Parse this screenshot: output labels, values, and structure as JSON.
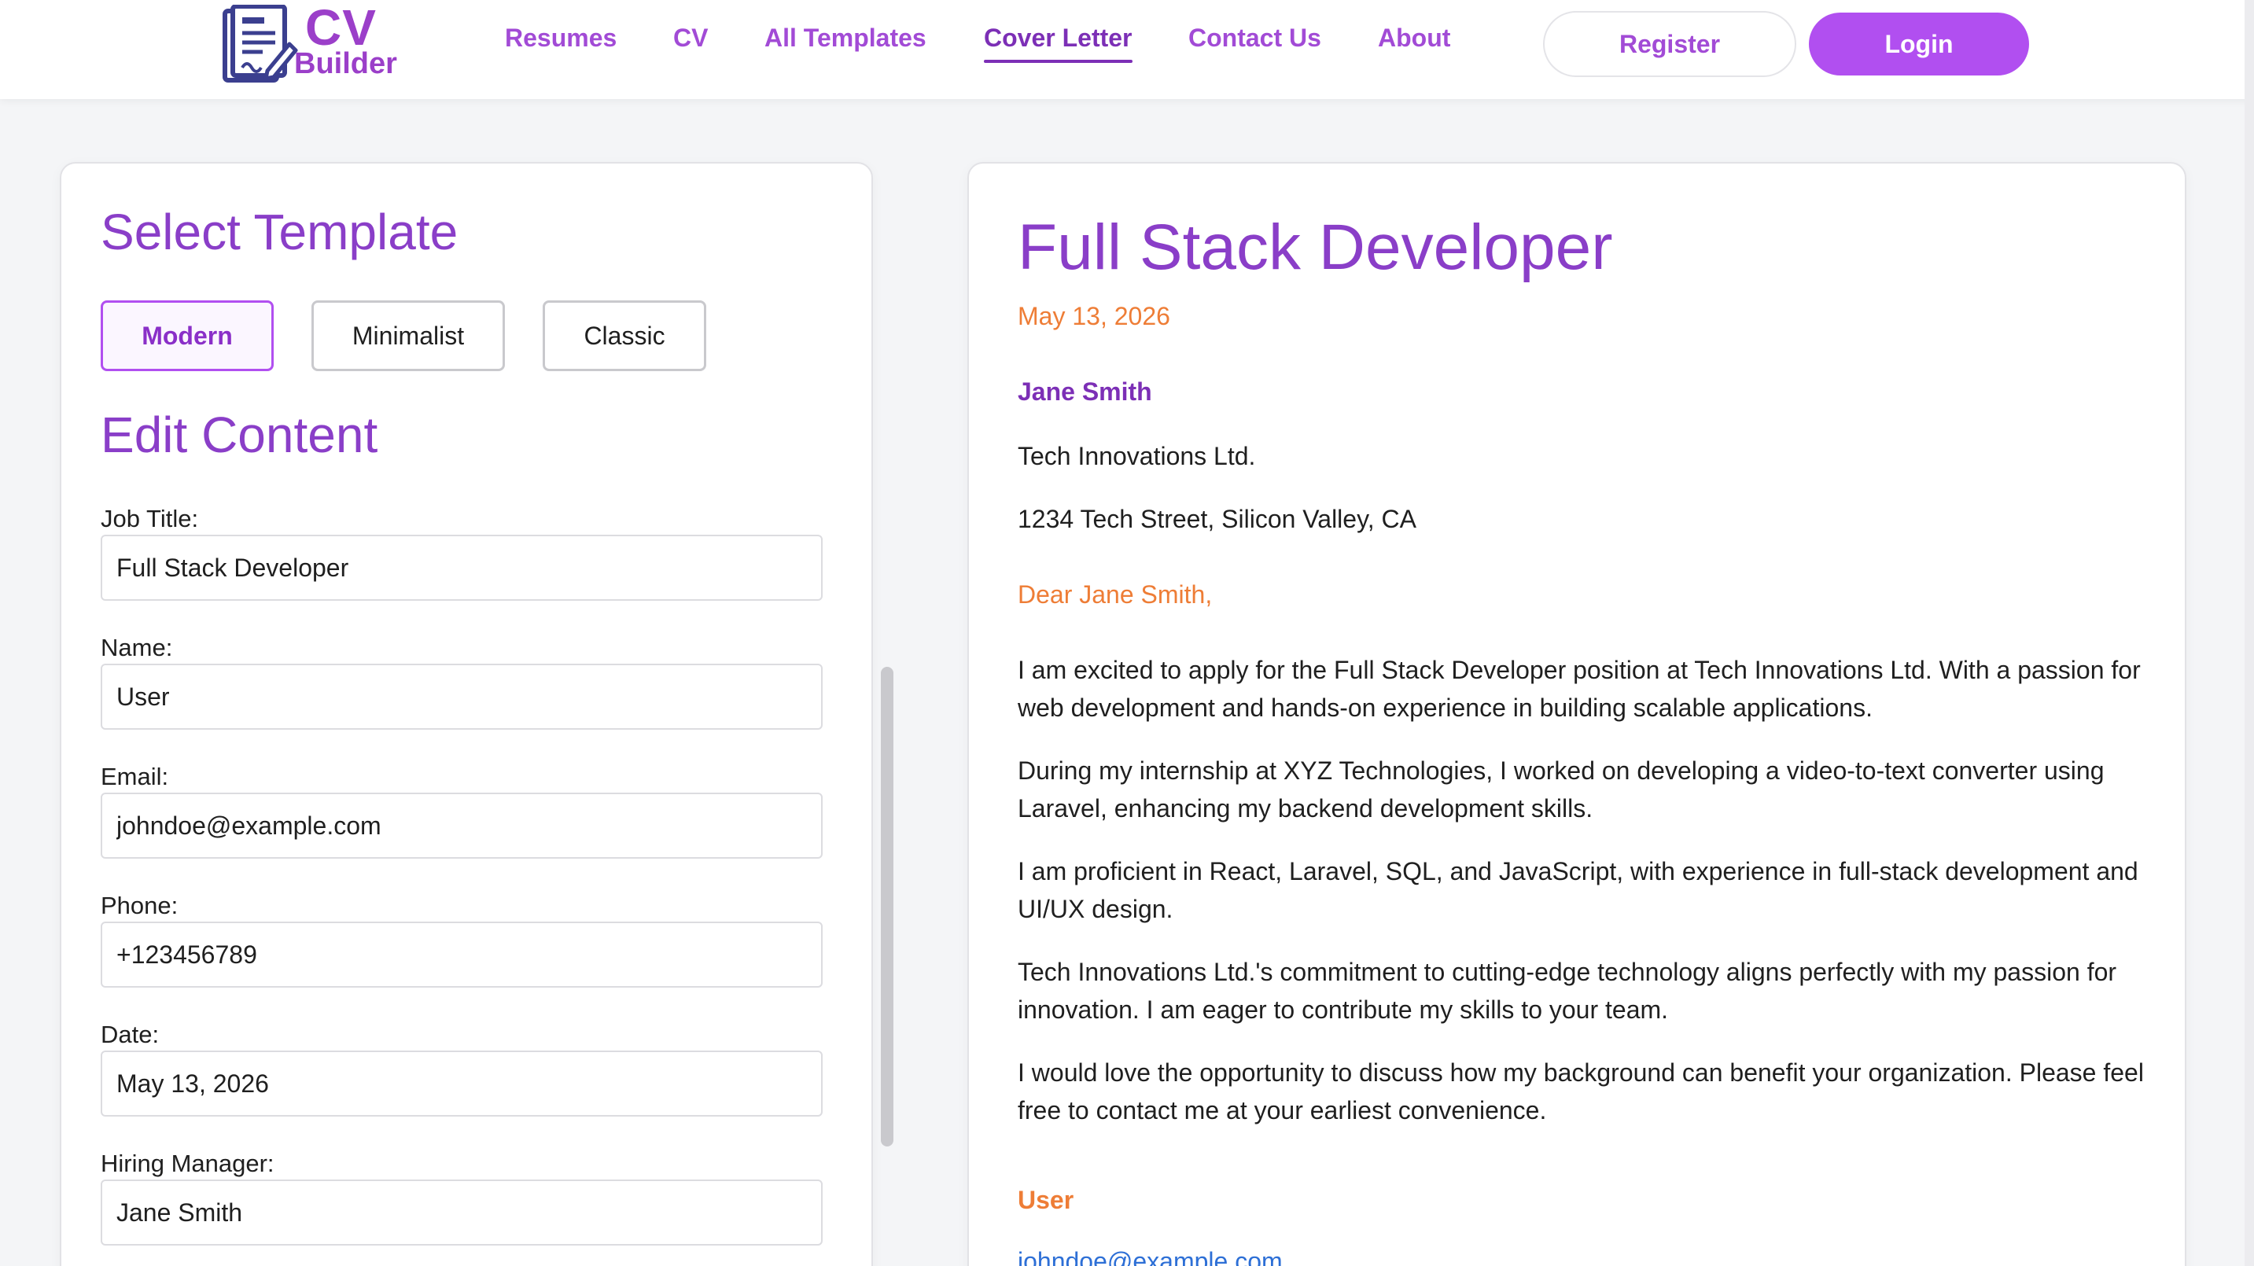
{
  "brand": {
    "cv": "CV",
    "builder": "Builder"
  },
  "nav": {
    "items": [
      {
        "label": "Resumes"
      },
      {
        "label": "CV"
      },
      {
        "label": "All Templates"
      },
      {
        "label": "Cover Letter",
        "active": true
      },
      {
        "label": "Contact Us"
      },
      {
        "label": "About"
      }
    ],
    "register_label": "Register",
    "login_label": "Login"
  },
  "colors": {
    "accent": "#a24bd6",
    "accent_dark": "#7c2fb6",
    "login_bg": "#b14ff0",
    "highlight_orange": "#ee7d36",
    "link_blue": "#2d6fd6"
  },
  "editor": {
    "select_template_heading": "Select Template",
    "templates": [
      {
        "label": "Modern",
        "active": true
      },
      {
        "label": "Minimalist"
      },
      {
        "label": "Classic"
      }
    ],
    "edit_content_heading": "Edit Content",
    "fields": [
      {
        "label": "Job Title:",
        "value": "Full Stack Developer"
      },
      {
        "label": "Name:",
        "value": "User"
      },
      {
        "label": "Email:",
        "value": "johndoe@example.com"
      },
      {
        "label": "Phone:",
        "value": "+123456789"
      },
      {
        "label": "Date:",
        "value": "May 13, 2026"
      },
      {
        "label": "Hiring Manager:",
        "value": "Jane Smith"
      }
    ]
  },
  "letter": {
    "title": "Full Stack Developer",
    "date": "May 13, 2026",
    "recipient_name": "Jane Smith",
    "company": "Tech Innovations Ltd.",
    "address": "1234 Tech Street, Silicon Valley, CA",
    "greeting": "Dear Jane Smith,",
    "paragraphs": [
      "I am excited to apply for the Full Stack Developer position at Tech Innovations Ltd. With a passion for web development and hands-on experience in building scalable applications.",
      "During my internship at XYZ Technologies, I worked on developing a video-to-text converter using Laravel, enhancing my backend development skills.",
      "I am proficient in React, Laravel, SQL, and JavaScript, with experience in full-stack development and UI/UX design.",
      "Tech Innovations Ltd.'s commitment to cutting-edge technology aligns perfectly with my passion for innovation. I am eager to contribute my skills to your team.",
      "I would love the opportunity to discuss how my background can benefit your organization. Please feel free to contact me at your earliest convenience."
    ],
    "signature": "User",
    "email": "johndoe@example.com"
  }
}
